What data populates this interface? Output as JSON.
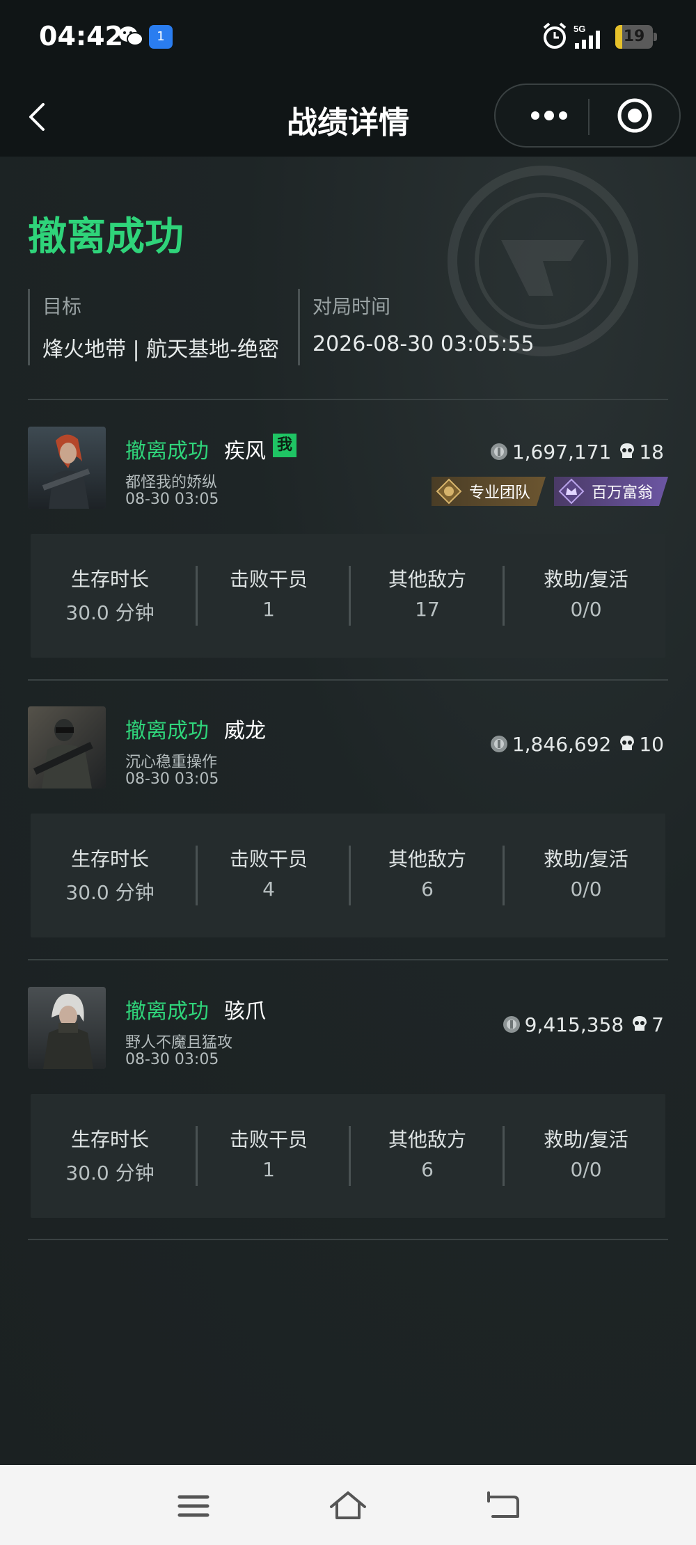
{
  "status_bar": {
    "time": "04:42",
    "nfc_label": "1",
    "network": "5G",
    "battery": "19",
    "battery_level": 0.19
  },
  "nav": {
    "title": "战绩详情"
  },
  "header": {
    "result": "撤离成功",
    "target_label": "目标",
    "target_value": "烽火地带 | 航天基地-绝密",
    "match_time_label": "对局时间",
    "match_time_value": "2026-08-30 03:05:55"
  },
  "stat_labels": {
    "survival": "生存时长",
    "kills": "击败干员",
    "other_enemies": "其他敌方",
    "assist": "救助/复活"
  },
  "players": [
    {
      "status": "撤离成功",
      "name": "疾风",
      "me_badge": "我",
      "signature": "都怪我的娇纵",
      "time": "08-30 03:05",
      "value": "1,697,171",
      "kill_count": "18",
      "tags": [
        {
          "label": "专业团队",
          "style": "gold"
        },
        {
          "label": "百万富翁",
          "style": "purple"
        }
      ],
      "survival": "30.0 分钟",
      "kills": "1",
      "other_enemies": "17",
      "assist": "0/0"
    },
    {
      "status": "撤离成功",
      "name": "威龙",
      "signature": "沉心稳重操作",
      "time": "08-30 03:05",
      "value": "1,846,692",
      "kill_count": "10",
      "survival": "30.0 分钟",
      "kills": "4",
      "other_enemies": "6",
      "assist": "0/0"
    },
    {
      "status": "撤离成功",
      "name": "骇爪",
      "signature": "野人不魔且猛攻",
      "time": "08-30 03:05",
      "value": "9,415,358",
      "kill_count": "7",
      "survival": "30.0 分钟",
      "kills": "1",
      "other_enemies": "6",
      "assist": "0/0"
    }
  ],
  "colors": {
    "success_green": "#2fd47a",
    "background": "#1c2223",
    "stat_panel": "#252c2d"
  }
}
